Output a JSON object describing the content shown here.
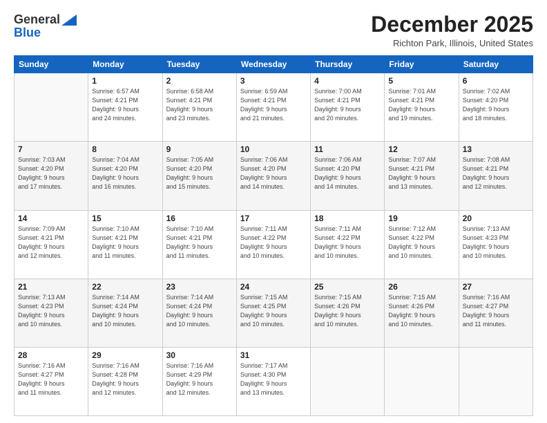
{
  "logo": {
    "general": "General",
    "blue": "Blue"
  },
  "header": {
    "month": "December 2025",
    "location": "Richton Park, Illinois, United States"
  },
  "days_of_week": [
    "Sunday",
    "Monday",
    "Tuesday",
    "Wednesday",
    "Thursday",
    "Friday",
    "Saturday"
  ],
  "weeks": [
    [
      {
        "day": "",
        "info": ""
      },
      {
        "day": "1",
        "info": "Sunrise: 6:57 AM\nSunset: 4:21 PM\nDaylight: 9 hours\nand 24 minutes."
      },
      {
        "day": "2",
        "info": "Sunrise: 6:58 AM\nSunset: 4:21 PM\nDaylight: 9 hours\nand 23 minutes."
      },
      {
        "day": "3",
        "info": "Sunrise: 6:59 AM\nSunset: 4:21 PM\nDaylight: 9 hours\nand 21 minutes."
      },
      {
        "day": "4",
        "info": "Sunrise: 7:00 AM\nSunset: 4:21 PM\nDaylight: 9 hours\nand 20 minutes."
      },
      {
        "day": "5",
        "info": "Sunrise: 7:01 AM\nSunset: 4:21 PM\nDaylight: 9 hours\nand 19 minutes."
      },
      {
        "day": "6",
        "info": "Sunrise: 7:02 AM\nSunset: 4:20 PM\nDaylight: 9 hours\nand 18 minutes."
      }
    ],
    [
      {
        "day": "7",
        "info": "Sunrise: 7:03 AM\nSunset: 4:20 PM\nDaylight: 9 hours\nand 17 minutes."
      },
      {
        "day": "8",
        "info": "Sunrise: 7:04 AM\nSunset: 4:20 PM\nDaylight: 9 hours\nand 16 minutes."
      },
      {
        "day": "9",
        "info": "Sunrise: 7:05 AM\nSunset: 4:20 PM\nDaylight: 9 hours\nand 15 minutes."
      },
      {
        "day": "10",
        "info": "Sunrise: 7:06 AM\nSunset: 4:20 PM\nDaylight: 9 hours\nand 14 minutes."
      },
      {
        "day": "11",
        "info": "Sunrise: 7:06 AM\nSunset: 4:20 PM\nDaylight: 9 hours\nand 14 minutes."
      },
      {
        "day": "12",
        "info": "Sunrise: 7:07 AM\nSunset: 4:21 PM\nDaylight: 9 hours\nand 13 minutes."
      },
      {
        "day": "13",
        "info": "Sunrise: 7:08 AM\nSunset: 4:21 PM\nDaylight: 9 hours\nand 12 minutes."
      }
    ],
    [
      {
        "day": "14",
        "info": "Sunrise: 7:09 AM\nSunset: 4:21 PM\nDaylight: 9 hours\nand 12 minutes."
      },
      {
        "day": "15",
        "info": "Sunrise: 7:10 AM\nSunset: 4:21 PM\nDaylight: 9 hours\nand 11 minutes."
      },
      {
        "day": "16",
        "info": "Sunrise: 7:10 AM\nSunset: 4:21 PM\nDaylight: 9 hours\nand 11 minutes."
      },
      {
        "day": "17",
        "info": "Sunrise: 7:11 AM\nSunset: 4:22 PM\nDaylight: 9 hours\nand 10 minutes."
      },
      {
        "day": "18",
        "info": "Sunrise: 7:11 AM\nSunset: 4:22 PM\nDaylight: 9 hours\nand 10 minutes."
      },
      {
        "day": "19",
        "info": "Sunrise: 7:12 AM\nSunset: 4:22 PM\nDaylight: 9 hours\nand 10 minutes."
      },
      {
        "day": "20",
        "info": "Sunrise: 7:13 AM\nSunset: 4:23 PM\nDaylight: 9 hours\nand 10 minutes."
      }
    ],
    [
      {
        "day": "21",
        "info": "Sunrise: 7:13 AM\nSunset: 4:23 PM\nDaylight: 9 hours\nand 10 minutes."
      },
      {
        "day": "22",
        "info": "Sunrise: 7:14 AM\nSunset: 4:24 PM\nDaylight: 9 hours\nand 10 minutes."
      },
      {
        "day": "23",
        "info": "Sunrise: 7:14 AM\nSunset: 4:24 PM\nDaylight: 9 hours\nand 10 minutes."
      },
      {
        "day": "24",
        "info": "Sunrise: 7:15 AM\nSunset: 4:25 PM\nDaylight: 9 hours\nand 10 minutes."
      },
      {
        "day": "25",
        "info": "Sunrise: 7:15 AM\nSunset: 4:26 PM\nDaylight: 9 hours\nand 10 minutes."
      },
      {
        "day": "26",
        "info": "Sunrise: 7:15 AM\nSunset: 4:26 PM\nDaylight: 9 hours\nand 10 minutes."
      },
      {
        "day": "27",
        "info": "Sunrise: 7:16 AM\nSunset: 4:27 PM\nDaylight: 9 hours\nand 11 minutes."
      }
    ],
    [
      {
        "day": "28",
        "info": "Sunrise: 7:16 AM\nSunset: 4:27 PM\nDaylight: 9 hours\nand 11 minutes."
      },
      {
        "day": "29",
        "info": "Sunrise: 7:16 AM\nSunset: 4:28 PM\nDaylight: 9 hours\nand 12 minutes."
      },
      {
        "day": "30",
        "info": "Sunrise: 7:16 AM\nSunset: 4:29 PM\nDaylight: 9 hours\nand 12 minutes."
      },
      {
        "day": "31",
        "info": "Sunrise: 7:17 AM\nSunset: 4:30 PM\nDaylight: 9 hours\nand 13 minutes."
      },
      {
        "day": "",
        "info": ""
      },
      {
        "day": "",
        "info": ""
      },
      {
        "day": "",
        "info": ""
      }
    ]
  ]
}
